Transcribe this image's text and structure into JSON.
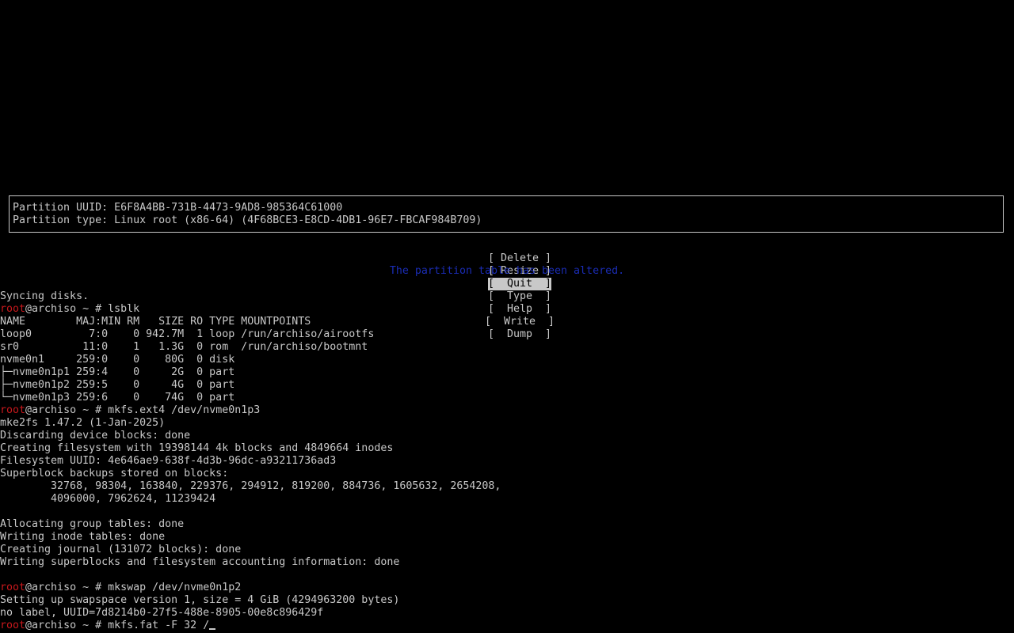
{
  "partition_info": {
    "uuid_line": "Partition UUID: E6F8A4BB-731B-4473-9AD8-985364C61000",
    "type_line": "Partition type: Linux root (x86-64) (4F68BCE3-E8CD-4DB1-96E7-FBCAF984B709)"
  },
  "menu": {
    "items": [
      "[ Delete ]",
      "[ Resize ]",
      "[  Quit  ]",
      "[  Type  ]",
      "[  Help  ]",
      "[  Write  ]",
      "[  Dump  ]"
    ],
    "selected": "Quit"
  },
  "status_message": "The partition table has been altered.",
  "prompt": {
    "user": "root",
    "host_rest": "@archiso ~ # "
  },
  "terminal": {
    "syncing": "Syncing disks.",
    "cmd_lsblk": "lsblk",
    "lsblk_header": "NAME        MAJ:MIN RM   SIZE RO TYPE MOUNTPOINTS",
    "lsblk_rows": [
      "loop0         7:0    0 942.7M  1 loop /run/archiso/airootfs",
      "sr0          11:0    1   1.3G  0 rom  /run/archiso/bootmnt",
      "nvme0n1     259:0    0    80G  0 disk",
      "├─nvme0n1p1 259:4    0     2G  0 part",
      "├─nvme0n1p2 259:5    0     4G  0 part",
      "└─nvme0n1p3 259:6    0    74G  0 part"
    ],
    "cmd_mkfs_ext4": "mkfs.ext4 /dev/nvme0n1p3",
    "ext4_output": [
      "mke2fs 1.47.2 (1-Jan-2025)",
      "Discarding device blocks: done",
      "Creating filesystem with 19398144 4k blocks and 4849664 inodes",
      "Filesystem UUID: 4e646ae9-638f-4d3b-96dc-a93211736ad3",
      "Superblock backups stored on blocks:",
      "        32768, 98304, 163840, 229376, 294912, 819200, 884736, 1605632, 2654208,",
      "        4096000, 7962624, 11239424",
      "",
      "Allocating group tables: done",
      "Writing inode tables: done",
      "Creating journal (131072 blocks): done",
      "Writing superblocks and filesystem accounting information: done"
    ],
    "cmd_mkswap": "mkswap /dev/nvme0n1p2",
    "mkswap_output": [
      "Setting up swapspace version 1, size = 4 GiB (4294963200 bytes)",
      "no label, UUID=7d8214b0-27f5-488e-8905-00e8c896429f"
    ],
    "cmd_current": "mkfs.fat -F 32 /"
  },
  "colors": {
    "background": "#000000",
    "foreground": "#c8c8c8",
    "prompt_user": "#c8181c",
    "status_blue": "#1a2cb4"
  }
}
